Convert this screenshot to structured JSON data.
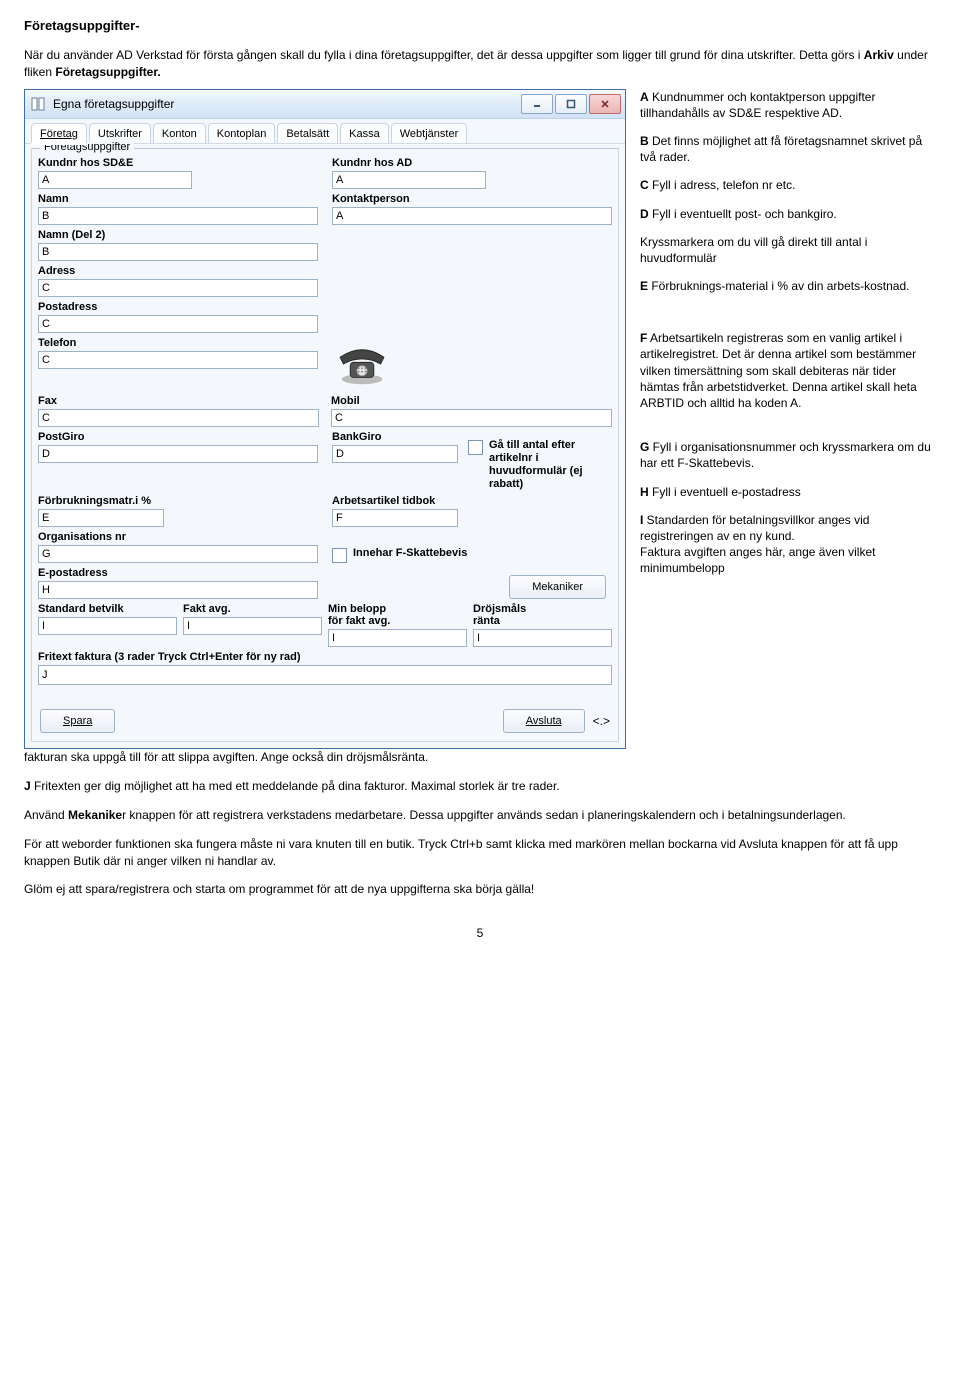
{
  "heading": "Företagsuppgifter-",
  "intro_before_bold": "När du använder AD Verkstad för första gången skall du fylla i dina företagsuppgifter, det är dessa uppgifter som ligger till grund för dina utskrifter. Detta görs i ",
  "intro_bold1": "Arkiv",
  "intro_mid": " under fliken ",
  "intro_bold2": "Företagsuppgifter.",
  "window": {
    "title": "Egna företagsuppgifter",
    "tabs": [
      "Företag",
      "Utskrifter",
      "Konton",
      "Kontoplan",
      "Betalsätt",
      "Kassa",
      "Webtjänster"
    ],
    "group_title": "Företagsuppgifter",
    "labels": {
      "kundnr_sde": "Kundnr hos SD&E",
      "kundnr_ad": "Kundnr hos AD",
      "namn": "Namn",
      "kontaktperson": "Kontaktperson",
      "namn_del2": "Namn (Del 2)",
      "adress": "Adress",
      "postadress": "Postadress",
      "telefon": "Telefon",
      "fax": "Fax",
      "mobil": "Mobil",
      "postgiro": "PostGiro",
      "bankgiro": "BankGiro",
      "forbruk": "Förbrukningsmatr.i %",
      "arbetsartikel": "Arbetsartikel tidbok",
      "orgnr": "Organisations nr",
      "epost": "E-postadress",
      "std_betvilk": "Standard betvilk",
      "fakt_avg": "Fakt avg.",
      "min_belopp": "Min belopp\nför fakt avg.",
      "drojs": "Dröjsmåls\nränta",
      "fritext": "Fritext faktura (3 rader Tryck Ctrl+Enter för ny rad)",
      "chk_antal": "Gå till antal efter artikelnr i huvudformulär (ej rabatt)",
      "chk_fskatt": "Innehar F-Skattebevis",
      "mekaniker": "Mekaniker",
      "spara": "Spara",
      "avsluta": "Avsluta",
      "ltgt": "<.>"
    },
    "values": {
      "kundnr_sde": "A",
      "kundnr_ad": "A",
      "namn": "B",
      "kontaktperson": "A",
      "namn_del2": "B",
      "adress": "C",
      "postadress": "C",
      "telefon": "C",
      "fax": "C",
      "mobil": "C",
      "postgiro": "D",
      "bankgiro": "D",
      "forbruk": "E",
      "arbetsartikel": "F",
      "orgnr": "G",
      "epost": "H",
      "std_betvilk": "I",
      "fakt_avg": "I",
      "min_belopp": "I",
      "drojs": "I",
      "fritext": "J"
    }
  },
  "legend": {
    "A_b": "A",
    "A": " Kundnummer och kontaktperson uppgifter tillhandahålls av SD&E respektive AD.",
    "B_b": "B",
    "B": " Det finns möjlighet att få företagsnamnet skrivet på två rader.",
    "C_b": "C",
    "C": " Fyll i adress, telefon nr etc.",
    "D_b": "D",
    "D": " Fyll i eventuellt post- och bankgiro.",
    "kryss": "Kryssmarkera om du vill gå direkt till antal i huvudformulär",
    "E_b": "E",
    "E": " Förbruknings-​material i % av din arbets-​kostnad.",
    "F_b": "F",
    "F": " Arbetsartikeln registreras som en vanlig artikel i artikelregistret. Det är denna artikel som bestämmer vilken timersättning som skall debiteras när tider hämtas från arbetstidverket. Denna artikel skall heta ARBTID och alltid ha koden A.",
    "G_b": "G",
    "G": " Fyll i organisationsnummer och kryssmarkera om du har ett F-Skattebevis.",
    "H_b": "H",
    "H": " Fyll i eventuell e-postadress",
    "I_b": "I",
    "I": " Standarden för betalningsvillkor anges vid registreringen av en ny kund.\nFaktura avgiften anges här, ange även vilket minimumbelopp "
  },
  "after": {
    "p1": "fakturan ska uppgå till för att slippa avgiften. Ange också din dröjsmålsränta.",
    "p2_b": "J",
    "p2": " Fritexten ger dig möjlighet att ha med ett meddelande på dina fakturor. Maximal storlek är tre rader.",
    "p3a": "Använd ",
    "p3b": "Mekanike",
    "p3c": "r knappen för att registrera verkstadens medarbetare. Dessa uppgifter används sedan i planeringskalendern och i betalningsunderlagen.",
    "p4": "För att weborder funktionen ska fungera måste ni vara knuten till en butik. Tryck Ctrl+b samt klicka med markören mellan bockarna vid Avsluta knappen för att få upp knappen Butik där ni anger vilken ni handlar av.",
    "p5": "Glöm ej att spara/registrera och starta om programmet för att de nya uppgifterna ska börja gälla!"
  },
  "page_number": "5"
}
